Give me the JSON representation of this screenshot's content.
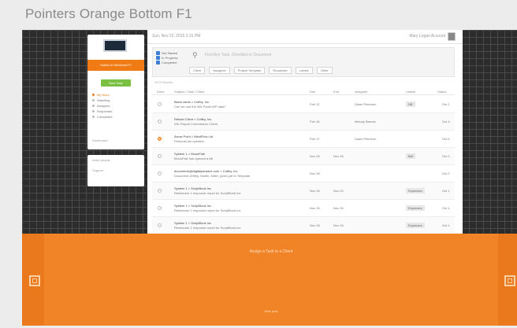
{
  "page": {
    "title": "Pointers Orange Bottom F1"
  },
  "sidebar": {
    "banner": "Switch to Windows/TV",
    "button": "New Task",
    "menu": [
      {
        "label": "My Work",
        "active": true
      },
      {
        "label": "Watching",
        "active": false
      },
      {
        "label": "Assigned",
        "active": false
      },
      {
        "label": "Requested",
        "active": false
      },
      {
        "label": "Completed",
        "active": false
      }
    ],
    "footer": "Dashboard",
    "links": [
      "Invite people",
      "Support"
    ]
  },
  "app": {
    "date": "Sun, Nov 22, 2015 2:31 PM",
    "user": "Mary Logan Account",
    "filters": [
      "Not Started",
      "In Progress",
      "Completed"
    ],
    "search_placeholder": "Find Any Task, Checklist or Document",
    "chips": [
      "Client",
      "Assignee",
      "Project Template",
      "Requester",
      "Labels",
      "Other"
    ],
    "table_caption": "2670 Results",
    "columns": [
      "Done",
      "Subject / Task / Client",
      "Due",
      "End",
      "Assignee",
      "Labels",
      "Status"
    ],
    "rows": [
      {
        "title": "Black cards > Coffey, Inc",
        "sub": "Can we use the Wix Panel WP data?",
        "due": "Feb 12",
        "end": "",
        "assignee": "Dawn Peterson",
        "label": "NB",
        "status": "Oct 1",
        "flag": false
      },
      {
        "title": "Rebain Client > Coffey, Inc",
        "sub": "WK Payroll Commission Check",
        "due": "Feb 18",
        "end": "",
        "assignee": "Melody Barnes",
        "label": "",
        "status": "Oct 4",
        "flag": false
      },
      {
        "title": "Arrow Point > MindFlow Ltd",
        "sub": "Personal tax question",
        "due": "Feb 17",
        "end": "",
        "assignee": "Dawn Peterson",
        "label": "",
        "status": "Oct 6",
        "flag": true
      },
      {
        "title": "System 1 > MoonFlair",
        "sub": "MoonFlair has opened a bill",
        "due": "Nov 26",
        "end": "Nov 26",
        "assignee": "",
        "label": "BM",
        "status": "Oct 2",
        "flag": false
      },
      {
        "title": "documents@digitalparadox.com > Coffey, Inc",
        "sub": "Document Jeffrey, Martin, Miller, jones pdf to Template",
        "due": "Nov 26",
        "end": "",
        "assignee": "",
        "label": "",
        "status": "Oct 2",
        "flag": false
      },
      {
        "title": "System 1 > ScriptBook Inc",
        "sub": "Reimburse 1 response report for ScriptBook Inc",
        "due": "Nov 26",
        "end": "Nov 26",
        "assignee": "",
        "label": "Expenses",
        "status": "Oct 1",
        "flag": false
      },
      {
        "title": "System 1 > ScriptBook Inc",
        "sub": "Reimburse 1 response report for ScriptBook Inc",
        "due": "Nov 26",
        "end": "Nov 26",
        "assignee": "",
        "label": "Expenses",
        "status": "Oct 1",
        "flag": false
      },
      {
        "title": "System 1 > ScriptBook Inc",
        "sub": "Reimburse 1 response report for ScriptBook Inc",
        "due": "Nov 26",
        "end": "Nov 26",
        "assignee": "",
        "label": "Expenses",
        "status": "Oct 1",
        "flag": false
      },
      {
        "title": "System 1 > ScriptBook Inc",
        "sub": "Reimburse 1 response report for ScriptBook Inc",
        "due": "Nov 26",
        "end": "Nov 26",
        "assignee": "",
        "label": "Expenses",
        "status": "Oct 1",
        "flag": false
      }
    ]
  },
  "overlay": {
    "title": "Assign a Task to a Client",
    "hide": "Hide post",
    "color": "#f18427",
    "icons": [
      "prev-arrow-icon",
      "next-arrow-icon"
    ]
  }
}
